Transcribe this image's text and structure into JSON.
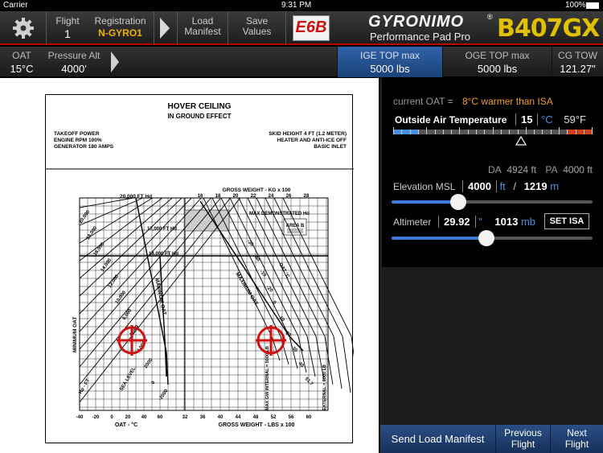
{
  "status": {
    "carrier": "Carrier",
    "time": "9:31 PM",
    "battery": "100%"
  },
  "topbar": {
    "flight_label": "Flight",
    "flight_value": "1",
    "reg_label": "Registration",
    "reg_value": "N-GYRO1",
    "load_label_1": "Load",
    "load_label_2": "Manifest",
    "save_label_1": "Save",
    "save_label_2": "Values",
    "e6b": "E6B",
    "brand": "GYRONIMO",
    "brand_sub": "Performance Pad Pro",
    "model": "B407GX"
  },
  "subbar": {
    "oat_label": "OAT",
    "oat_value": "15°C",
    "pa_label": "Pressure Alt",
    "pa_value": "4000'",
    "ige_label": "IGE TOP max",
    "ige_value": "5000 lbs",
    "oge_label": "OGE TOP max",
    "oge_value": "5000 lbs",
    "cg_label": "CG TOW",
    "cg_value": "121.27\""
  },
  "chart": {
    "title": "HOVER CEILING",
    "subtitle": "IN GROUND EFFECT",
    "left_info": [
      "TAKEOFF POWER",
      "ENGINE RPM 100%",
      "GENERATOR 180 AMPS"
    ],
    "right_info": [
      "SKID HEIGHT 4 FT (1.2 METER)",
      "HEATER AND ANTI-ICE OFF",
      "BASIC INLET"
    ],
    "gw_kg_label": "GROSS WEIGHT - KG x 100",
    "gw_lbs_label": "GROSS WEIGHT - LBS x 100",
    "oat_axis_label": "OAT - °C",
    "min_oat": "MINIMUM OAT",
    "max_oat": "MAXIMUM OAT",
    "max_demo": "MAX DEMONSTRATED Hd",
    "area_b": "AREA B",
    "oat_tag": "OAT °C",
    "hd_20000": "20,000 FT Hd",
    "hd_17000": "17,000 FT Hd",
    "hd_14000": "14,000 FT Hd",
    "sea_level": "SEA LEVEL",
    "max_gw": "MAX GW INTERNAL = 5000 LB",
    "external": "EXTERNAL = 6000 LB",
    "hp_ft": "Hp - FT",
    "alt_labels": [
      "20,000",
      "18,000",
      "16,000",
      "14,000",
      "12,000",
      "10,000",
      "8,000",
      "6,000",
      "4,000",
      "2000",
      "0",
      "-2000"
    ],
    "oat_ticks": [
      "-40",
      "-20",
      "0",
      "20",
      "40",
      "60"
    ],
    "kg_ticks": [
      "16",
      "18",
      "20",
      "22",
      "24",
      "26",
      "28"
    ],
    "lbs_ticks": [
      "32",
      "36",
      "40",
      "44",
      "48",
      "52",
      "56",
      "60"
    ],
    "temp_curve_labels": [
      "-30",
      "-40",
      "-10",
      "-20",
      "0",
      "10",
      "20",
      "30",
      "40",
      "51.7"
    ]
  },
  "panel": {
    "current_oat_label": "current OAT =",
    "current_oat_value": "8°C warmer than ISA",
    "oat_field_label": "Outside Air Temperature",
    "oat_c": "15",
    "oat_c_unit": "°C",
    "oat_f": "59°F",
    "da_label": "DA",
    "da_value": "4924 ft",
    "pa_label": "PA",
    "pa_value": "4000 ft",
    "elev_label": "Elevation MSL",
    "elev_ft": "4000",
    "elev_ft_unit": "ft",
    "slash": "/",
    "elev_m": "1219",
    "elev_m_unit": "m",
    "alt_label": "Altimeter",
    "alt_inhg": "29.92",
    "alt_inhg_unit": "\"",
    "alt_mb": "1013",
    "alt_mb_unit": "mb",
    "set_isa": "SET ISA",
    "elev_slider_fraction": 0.33,
    "alt_slider_fraction": 0.47,
    "oat_pointer_fraction": 0.64
  },
  "bottom": {
    "send": "Send Load Manifest",
    "prev_1": "Previous",
    "prev_2": "Flight",
    "next_1": "Next",
    "next_2": "Flight"
  },
  "colors": {
    "accent_red": "#cc1111",
    "orange": "#f0a020",
    "link_blue": "#4a90e2"
  }
}
